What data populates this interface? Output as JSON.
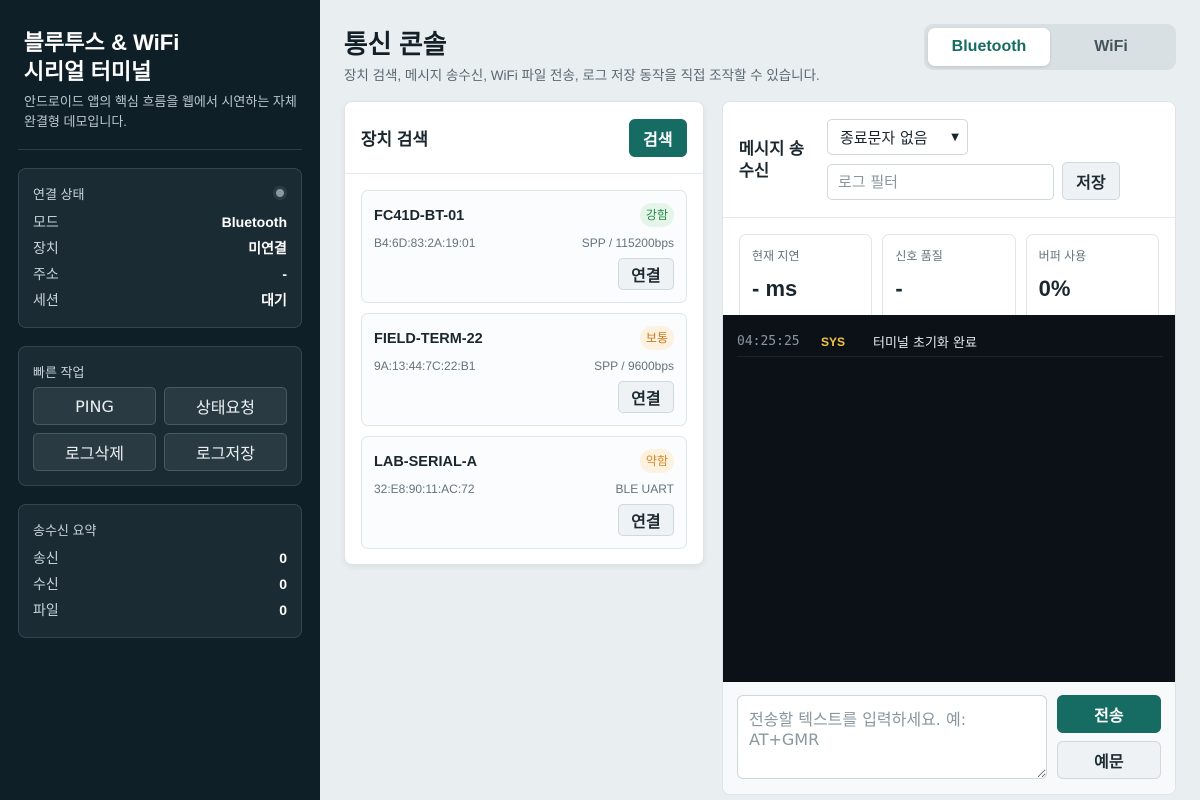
{
  "sidebar": {
    "title_line1": "블루투스 & WiFi",
    "title_line2": "시리얼 터미널",
    "description": "안드로이드 앱의 핵심 흐름을 웹에서 시연하는 자체완결형 데모입니다.",
    "connection": {
      "heading": "연결 상태",
      "rows": [
        {
          "label": "모드",
          "value": "Bluetooth"
        },
        {
          "label": "장치",
          "value": "미연결"
        },
        {
          "label": "주소",
          "value": "-"
        },
        {
          "label": "세션",
          "value": "대기"
        }
      ]
    },
    "quick_actions": {
      "heading": "빠른 작업",
      "buttons": [
        "PING",
        "상태요청",
        "로그삭제",
        "로그저장"
      ]
    },
    "summary": {
      "heading": "송수신 요약",
      "rows": [
        {
          "label": "송신",
          "value": "0"
        },
        {
          "label": "수신",
          "value": "0"
        },
        {
          "label": "파일",
          "value": "0"
        }
      ]
    }
  },
  "header": {
    "title": "통신 콘솔",
    "subtitle": "장치 검색, 메시지 송수신, WiFi 파일 전송, 로그 저장 동작을 직접 조작할 수 있습니다."
  },
  "mode_toggle": {
    "options": [
      "Bluetooth",
      "WiFi"
    ],
    "active": "Bluetooth"
  },
  "device_panel": {
    "title": "장치 검색",
    "scan_label": "검색",
    "connect_label": "연결",
    "devices": [
      {
        "name": "FC41D-BT-01",
        "signal": "강함",
        "mac": "B4:6D:83:2A:19:01",
        "protocol": "SPP / 115200bps"
      },
      {
        "name": "FIELD-TERM-22",
        "signal": "보통",
        "mac": "9A:13:44:7C:22:B1",
        "protocol": "SPP / 9600bps"
      },
      {
        "name": "LAB-SERIAL-A",
        "signal": "약함",
        "mac": "32:E8:90:11:AC:72",
        "protocol": "BLE UART"
      }
    ]
  },
  "message_panel": {
    "title": "메시지 송수신",
    "terminator_selected": "종료문자 없음",
    "filter_placeholder": "로그 필터",
    "save_label": "저장",
    "stats": [
      {
        "label": "현재 지연",
        "value": "- ms"
      },
      {
        "label": "신호 품질",
        "value": "-"
      },
      {
        "label": "버퍼 사용",
        "value": "0%"
      }
    ],
    "log": [
      {
        "time": "04:25:25",
        "tag": "SYS",
        "message": "터미널 초기화 완료"
      }
    ],
    "input_placeholder": "전송할 텍스트를 입력하세요. 예: AT+GMR",
    "send_label": "전송",
    "example_label": "예문"
  },
  "colors": {
    "sidebar_bg": "#0f1f28",
    "accent": "#166b63",
    "terminal_bg": "#0b1117",
    "log_tag": "#f5c542"
  }
}
